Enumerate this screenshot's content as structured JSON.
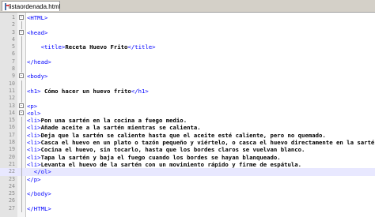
{
  "tab": {
    "label": "listaordenada.html",
    "icon": "html-file-icon"
  },
  "colors": {
    "tag": "#0000ff",
    "text": "#000000",
    "current_line": "#e8e8ff",
    "gutter": "#e4e4e4"
  },
  "lines": [
    {
      "n": "1",
      "fold": "-",
      "tag1": "<HTML>",
      "text": "",
      "tag2": "",
      "indent": ""
    },
    {
      "n": "2",
      "fold": "",
      "tag1": "",
      "text": "",
      "tag2": "",
      "indent": ""
    },
    {
      "n": "3",
      "fold": "-",
      "tag1": "<head>",
      "text": "",
      "tag2": "",
      "indent": ""
    },
    {
      "n": "4",
      "fold": "",
      "tag1": "",
      "text": "",
      "tag2": "",
      "indent": ""
    },
    {
      "n": "5",
      "fold": "",
      "tag1": "<title>",
      "text": "Receta Huevo Frito",
      "tag2": "</title>",
      "indent": "    "
    },
    {
      "n": "6",
      "fold": "",
      "tag1": "",
      "text": "",
      "tag2": "",
      "indent": ""
    },
    {
      "n": "7",
      "fold": "",
      "tag1": "</head>",
      "text": "",
      "tag2": "",
      "indent": ""
    },
    {
      "n": "8",
      "fold": "",
      "tag1": "",
      "text": "",
      "tag2": "",
      "indent": ""
    },
    {
      "n": "9",
      "fold": "-",
      "tag1": "<body>",
      "text": "",
      "tag2": "",
      "indent": ""
    },
    {
      "n": "10",
      "fold": "",
      "tag1": "",
      "text": "",
      "tag2": "",
      "indent": ""
    },
    {
      "n": "11",
      "fold": "",
      "tag1": "<h1>",
      "text": " Cómo hacer un huevo frito",
      "tag2": "</h1>",
      "indent": ""
    },
    {
      "n": "12",
      "fold": "",
      "tag1": "",
      "text": "",
      "tag2": "",
      "indent": ""
    },
    {
      "n": "13",
      "fold": "-",
      "tag1": "<p>",
      "text": "",
      "tag2": "",
      "indent": ""
    },
    {
      "n": "14",
      "fold": "-",
      "tag1": "<ol>",
      "text": "",
      "tag2": "",
      "indent": ""
    },
    {
      "n": "15",
      "fold": "",
      "tag1": "<li>",
      "text": "Pon una sartén en la cocina a fuego medio.",
      "tag2": "",
      "indent": ""
    },
    {
      "n": "16",
      "fold": "",
      "tag1": "<li>",
      "text": "Añade aceite a la sartén mientras se calienta.",
      "tag2": "",
      "indent": ""
    },
    {
      "n": "17",
      "fold": "",
      "tag1": "<li>",
      "text": "Deja que la sartén se caliente hasta que el aceite esté caliente, pero no quemado.",
      "tag2": "",
      "indent": ""
    },
    {
      "n": "18",
      "fold": "",
      "tag1": "<li>",
      "text": "Casca el huevo en un plato o tazón pequeño y viértelo, o casca el huevo directamente en la sartén.",
      "tag2": "",
      "indent": ""
    },
    {
      "n": "19",
      "fold": "",
      "tag1": "<li>",
      "text": "Cocina el huevo, sin tocarlo, hasta que los bordes claros se vuelvan blanco.",
      "tag2": "",
      "indent": ""
    },
    {
      "n": "20",
      "fold": "",
      "tag1": "<li>",
      "text": "Tapa la sartén y baja el fuego cuando los bordes se hayan blanqueado.",
      "tag2": "",
      "indent": ""
    },
    {
      "n": "21",
      "fold": "",
      "tag1": "<li>",
      "text": "Levanta el huevo de la sartén con un movimiento rápido y firme de espátula.",
      "tag2": "",
      "indent": ""
    },
    {
      "n": "22",
      "fold": "",
      "tag1": "</ol>",
      "text": "",
      "tag2": "",
      "indent": "  ",
      "current": true
    },
    {
      "n": "23",
      "fold": "",
      "tag1": "</p>",
      "text": "",
      "tag2": "",
      "indent": ""
    },
    {
      "n": "24",
      "fold": "",
      "tag1": "",
      "text": "",
      "tag2": "",
      "indent": ""
    },
    {
      "n": "25",
      "fold": "",
      "tag1": "</body>",
      "text": "",
      "tag2": "",
      "indent": ""
    },
    {
      "n": "26",
      "fold": "",
      "tag1": "",
      "text": "",
      "tag2": "",
      "indent": ""
    },
    {
      "n": "27",
      "fold": "",
      "tag1": "</HTML>",
      "text": "",
      "tag2": "",
      "indent": ""
    }
  ]
}
